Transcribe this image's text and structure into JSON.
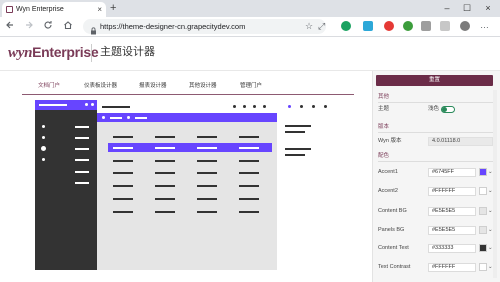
{
  "browser": {
    "tab_title": "Wyn Enterprise",
    "tab_close": "×",
    "new_tab": "+",
    "win_min": "–",
    "win_max": "☐",
    "win_close": "×",
    "url": "https://theme-designer-cn.grapecitydev.com"
  },
  "app": {
    "logo_w": "wyn",
    "logo_rest": "Enterprise",
    "title": "主题设计器"
  },
  "nav_tabs": [
    "文档门户",
    "仪表板设计器",
    "报表设计器",
    "其他设计器",
    "管理门户"
  ],
  "panel": {
    "save_label": "重置",
    "sections": {
      "other": "其他",
      "version": "版本",
      "colors": "配色"
    },
    "theme_label": "主题",
    "theme_value": "浅色",
    "version_label": "Wyn 版本",
    "version_value": "4.0.01118.0",
    "colors": [
      {
        "label": "Accent1",
        "value": "#6745FF",
        "swatch": "#6745FF"
      },
      {
        "label": "Accent2",
        "value": "#FFFFFF",
        "swatch": "#FFFFFF"
      },
      {
        "label": "Content BG",
        "value": "#E5E5E5",
        "swatch": "#E5E5E5"
      },
      {
        "label": "Panels BG",
        "value": "#E5E5E5",
        "swatch": "#E5E5E5"
      },
      {
        "label": "Content Text",
        "value": "#333333",
        "swatch": "#333333"
      },
      {
        "label": "Text Contrast",
        "value": "#FFFFFF",
        "swatch": "#FFFFFF"
      }
    ]
  }
}
